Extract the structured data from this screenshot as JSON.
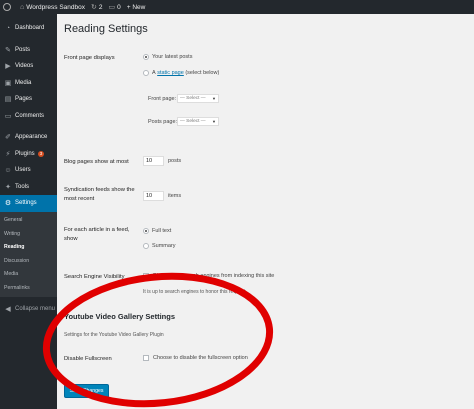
{
  "adminbar": {
    "site_name": "Wordpress Sandbox",
    "updates_count": "2",
    "comments_count": "0",
    "new_label": "+ New"
  },
  "sidebar": {
    "items": [
      {
        "label": "Dashboard",
        "icon": "dashboard-icon"
      },
      {
        "label": "Posts",
        "icon": "pin-icon"
      },
      {
        "label": "Videos",
        "icon": "video-icon"
      },
      {
        "label": "Media",
        "icon": "media-icon"
      },
      {
        "label": "Pages",
        "icon": "page-icon"
      },
      {
        "label": "Comments",
        "icon": "comment-icon"
      },
      {
        "label": "Appearance",
        "icon": "brush-icon"
      },
      {
        "label": "Plugins",
        "icon": "plug-icon",
        "badge": "3"
      },
      {
        "label": "Users",
        "icon": "user-icon"
      },
      {
        "label": "Tools",
        "icon": "wrench-icon"
      },
      {
        "label": "Settings",
        "icon": "settings-icon"
      }
    ],
    "submenu": [
      "General",
      "Writing",
      "Reading",
      "Discussion",
      "Media",
      "Permalinks"
    ],
    "collapse_label": "Collapse menu"
  },
  "page": {
    "title": "Reading Settings",
    "front_page_displays": "Front page displays",
    "opt_latest_posts": "Your latest posts",
    "opt_static_page_link": "static page",
    "opt_static_page_prefix": "A",
    "opt_static_page_suffix": "(select below)",
    "front_page_label": "Front page:",
    "posts_page_label": "Posts page:",
    "select_placeholder": "— Select —",
    "blog_pages_label": "Blog pages show at most",
    "blog_pages_value": "10",
    "blog_pages_unit": "posts",
    "syndication_label_1": "Syndication feeds show the",
    "syndication_label_2": "most recent",
    "syndication_value": "10",
    "syndication_unit": "items",
    "article_feed_label_1": "For each article in a feed,",
    "article_feed_label_2": "show",
    "opt_full_text": "Full text",
    "opt_summary": "Summary",
    "search_visibility_label": "Search Engine Visibility",
    "search_visibility_option": "Discourage search engines from indexing this site",
    "search_visibility_note": "It is up to search engines to honor this request.",
    "yt_section_title": "Youtube Video Gallery Settings",
    "yt_section_desc": "Settings for the Youtube Video Gallery Plugin",
    "disable_fullscreen_label": "Disable Fullscreen",
    "disable_fullscreen_option": "Choose to disable the fullscreen option",
    "save_button": "Save Changes"
  },
  "colors": {
    "admin_bg": "#23282d",
    "accent": "#0073aa",
    "annotation": "#e00000"
  }
}
